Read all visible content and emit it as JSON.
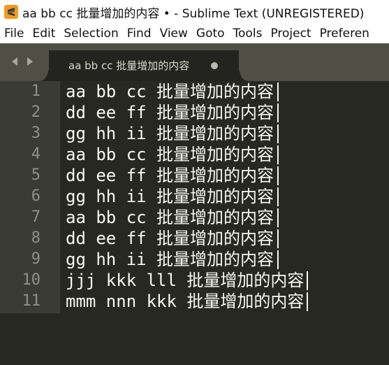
{
  "window": {
    "title": "aa bb cc 批量增加的内容 • - Sublime Text (UNREGISTERED)",
    "app_icon": "sublime-text-icon"
  },
  "menu": {
    "items": [
      "File",
      "Edit",
      "Selection",
      "Find",
      "View",
      "Goto",
      "Tools",
      "Project",
      "Preferen"
    ]
  },
  "tabbar": {
    "nav_icons": [
      "chevron-left-icon",
      "chevron-right-icon"
    ],
    "active_tab": {
      "label": "aa bb cc 批量增加的内容",
      "dirty_indicator": "unsaved-dot-icon"
    }
  },
  "editor": {
    "lines": [
      {
        "number": "1",
        "text": "aa bb cc 批量增加的内容"
      },
      {
        "number": "2",
        "text": "dd ee ff 批量增加的内容"
      },
      {
        "number": "3",
        "text": "gg hh ii 批量增加的内容"
      },
      {
        "number": "4",
        "text": "aa bb cc 批量增加的内容"
      },
      {
        "number": "5",
        "text": "dd ee ff 批量增加的内容"
      },
      {
        "number": "6",
        "text": "gg hh ii 批量增加的内容"
      },
      {
        "number": "7",
        "text": "aa bb cc 批量增加的内容"
      },
      {
        "number": "8",
        "text": "dd ee ff 批量增加的内容"
      },
      {
        "number": "9",
        "text": "gg hh ii 批量增加的内容"
      },
      {
        "number": "10",
        "text": "jjj kkk lll 批量增加的内容"
      },
      {
        "number": "11",
        "text": "mmm nnn kkk 批量增加的内容"
      }
    ]
  },
  "colors": {
    "editor_background": "#272822",
    "gutter_background": "#3a3b33",
    "tabbar_background": "#4f4f46",
    "text": "#f8f8f2",
    "line_number": "#8f908a"
  }
}
